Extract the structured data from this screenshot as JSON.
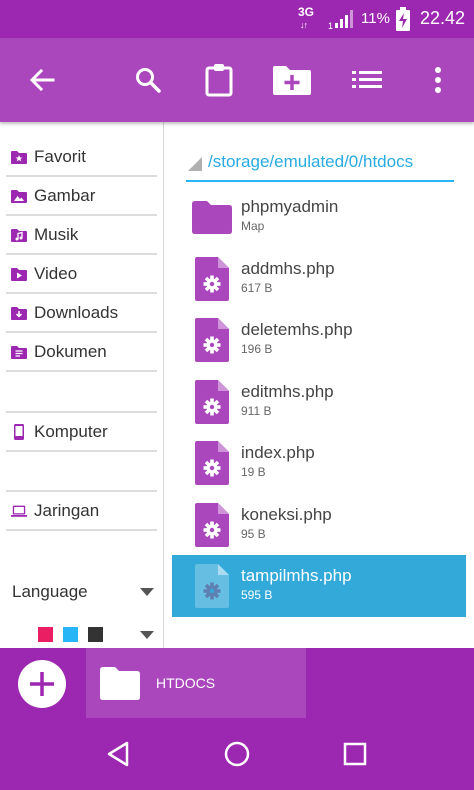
{
  "status_bar": {
    "network": "3G",
    "network_arrows": "↓↑",
    "sim_slot": "1",
    "battery_percent": "11%",
    "time": "22.42",
    "icons": [
      "signal-icon",
      "battery-charging-icon"
    ]
  },
  "toolbar": {
    "icons": [
      "back-arrow-icon",
      "search-icon",
      "clipboard-icon",
      "new-folder-icon",
      "list-view-icon",
      "overflow-menu-icon"
    ]
  },
  "sidebar": {
    "items": [
      {
        "label": "Favorit",
        "icon": "favorite-folder-icon"
      },
      {
        "label": "Gambar",
        "icon": "image-folder-icon"
      },
      {
        "label": "Musik",
        "icon": "music-folder-icon"
      },
      {
        "label": "Video",
        "icon": "video-folder-icon"
      },
      {
        "label": "Downloads",
        "icon": "download-folder-icon"
      },
      {
        "label": "Dokumen",
        "icon": "document-folder-icon"
      },
      {
        "label": "Komputer",
        "icon": "phone-icon"
      },
      {
        "label": "Jaringan",
        "icon": "laptop-icon"
      }
    ],
    "language_label": "Language",
    "theme_colors": [
      "#E91E63",
      "#29B6F6",
      "#333333"
    ]
  },
  "main": {
    "path": "/storage/emulated/0/htdocs",
    "files": [
      {
        "name": "phpmyadmin",
        "meta": "Map",
        "type": "folder",
        "selected": false
      },
      {
        "name": "addmhs.php",
        "meta": "617 B",
        "type": "file",
        "selected": false
      },
      {
        "name": "deletemhs.php",
        "meta": "196 B",
        "type": "file",
        "selected": false
      },
      {
        "name": "editmhs.php",
        "meta": "911 B",
        "type": "file",
        "selected": false
      },
      {
        "name": "index.php",
        "meta": "19 B",
        "type": "file",
        "selected": false
      },
      {
        "name": "koneksi.php",
        "meta": "95 B",
        "type": "file",
        "selected": false
      },
      {
        "name": "tampilmhs.php",
        "meta": "595 B",
        "type": "file",
        "selected": true
      }
    ]
  },
  "bottom_bar": {
    "tab_label": "HTDOCS"
  },
  "colors": {
    "primary": "#9C27B0",
    "toolbar": "#AB47BC",
    "accent": "#29B6F6",
    "selection": "#33A9DA"
  }
}
